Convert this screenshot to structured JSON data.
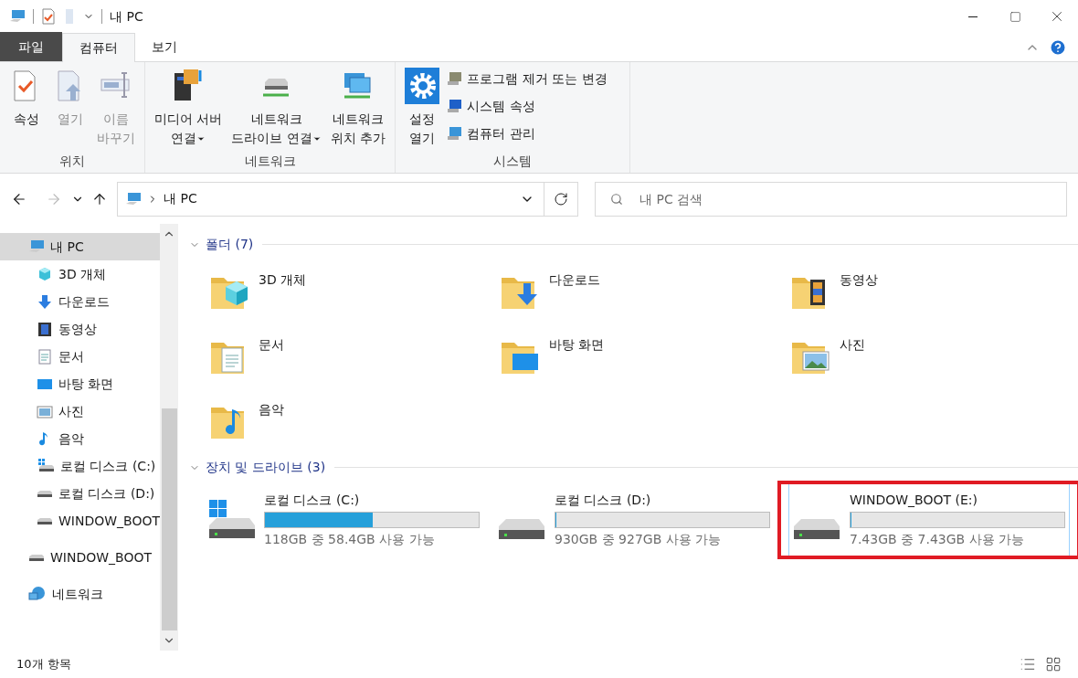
{
  "window": {
    "title": "내 PC"
  },
  "ribbon_tabs": [
    {
      "label": "파일",
      "kind": "file",
      "selected": false
    },
    {
      "label": "컴퓨터",
      "kind": "tab",
      "selected": true
    },
    {
      "label": "보기",
      "kind": "tab",
      "selected": false
    }
  ],
  "ribbon_groups": [
    {
      "label": "위치",
      "buttons": [
        {
          "label": "속성",
          "kind": "properties",
          "disabled": false
        },
        {
          "label": "열기",
          "kind": "open",
          "disabled": true
        },
        {
          "label": "이름\n바꾸기",
          "kind": "rename",
          "disabled": true
        }
      ]
    },
    {
      "label": "네트워크",
      "buttons": [
        {
          "label": "미디어 서버\n연결",
          "kind": "media",
          "dropdown": true
        },
        {
          "label": "네트워크\n드라이브 연결",
          "kind": "netdrive",
          "dropdown": true
        },
        {
          "label": "네트워크\n위치 추가",
          "kind": "netloc",
          "dropdown": false
        }
      ]
    },
    {
      "label": "시스템",
      "buttons": [
        {
          "label": "설정\n열기",
          "kind": "settings"
        }
      ],
      "links": [
        {
          "label": "프로그램 제거 또는 변경",
          "kind": "uninstall"
        },
        {
          "label": "시스템 속성",
          "kind": "sysprops"
        },
        {
          "label": "컴퓨터 관리",
          "kind": "manage"
        }
      ]
    }
  ],
  "address": {
    "crumbs": [
      "내 PC"
    ]
  },
  "search": {
    "placeholder": "내 PC 검색"
  },
  "sidebar": {
    "items": [
      {
        "label": "내 PC",
        "kind": "pc",
        "selected": true,
        "children": [
          {
            "label": "3D 개체",
            "kind": "objects3d",
            "selected": false
          },
          {
            "label": "다운로드",
            "kind": "downloads",
            "selected": false
          },
          {
            "label": "동영상",
            "kind": "videos",
            "selected": false
          },
          {
            "label": "문서",
            "kind": "documents",
            "selected": false
          },
          {
            "label": "바탕 화면",
            "kind": "desktop",
            "selected": false
          },
          {
            "label": "사진",
            "kind": "pictures",
            "selected": false
          },
          {
            "label": "음악",
            "kind": "music",
            "selected": false
          },
          {
            "label": "로컬 디스크 (C:)",
            "kind": "osdrive",
            "selected": false
          },
          {
            "label": "로컬 디스크 (D:)",
            "kind": "drive",
            "selected": false
          },
          {
            "label": "WINDOW_BOOT",
            "kind": "drive",
            "selected": false
          }
        ]
      },
      {
        "label": "WINDOW_BOOT",
        "kind": "drive",
        "selected": false
      },
      {
        "label": "네트워크",
        "kind": "network",
        "selected": false
      }
    ]
  },
  "folders": {
    "header": "폴더 (7)",
    "items": [
      {
        "label": "3D 개체",
        "kind": "objects3d"
      },
      {
        "label": "다운로드",
        "kind": "downloads"
      },
      {
        "label": "동영상",
        "kind": "videos"
      },
      {
        "label": "문서",
        "kind": "documents"
      },
      {
        "label": "바탕 화면",
        "kind": "desktop"
      },
      {
        "label": "사진",
        "kind": "pictures"
      },
      {
        "label": "음악",
        "kind": "music"
      }
    ]
  },
  "drives": {
    "header": "장치 및 드라이브 (3)",
    "items": [
      {
        "label": "로컬 디스크 (C:)",
        "kind": "osdrive",
        "level": 0.505,
        "free": "118GB 중 58.4GB 사용 가능",
        "selected": false,
        "highlighted": false
      },
      {
        "label": "로컬 디스크 (D:)",
        "kind": "drive",
        "level": 0.003,
        "free": "930GB 중 927GB 사용 가능",
        "selected": false,
        "highlighted": false
      },
      {
        "label": "WINDOW_BOOT (E:)",
        "kind": "drive",
        "level": 0,
        "free": "7.43GB 중 7.43GB 사용 가능",
        "selected": true,
        "highlighted": true
      }
    ]
  },
  "status_bar": {
    "count": "10개 항목"
  }
}
